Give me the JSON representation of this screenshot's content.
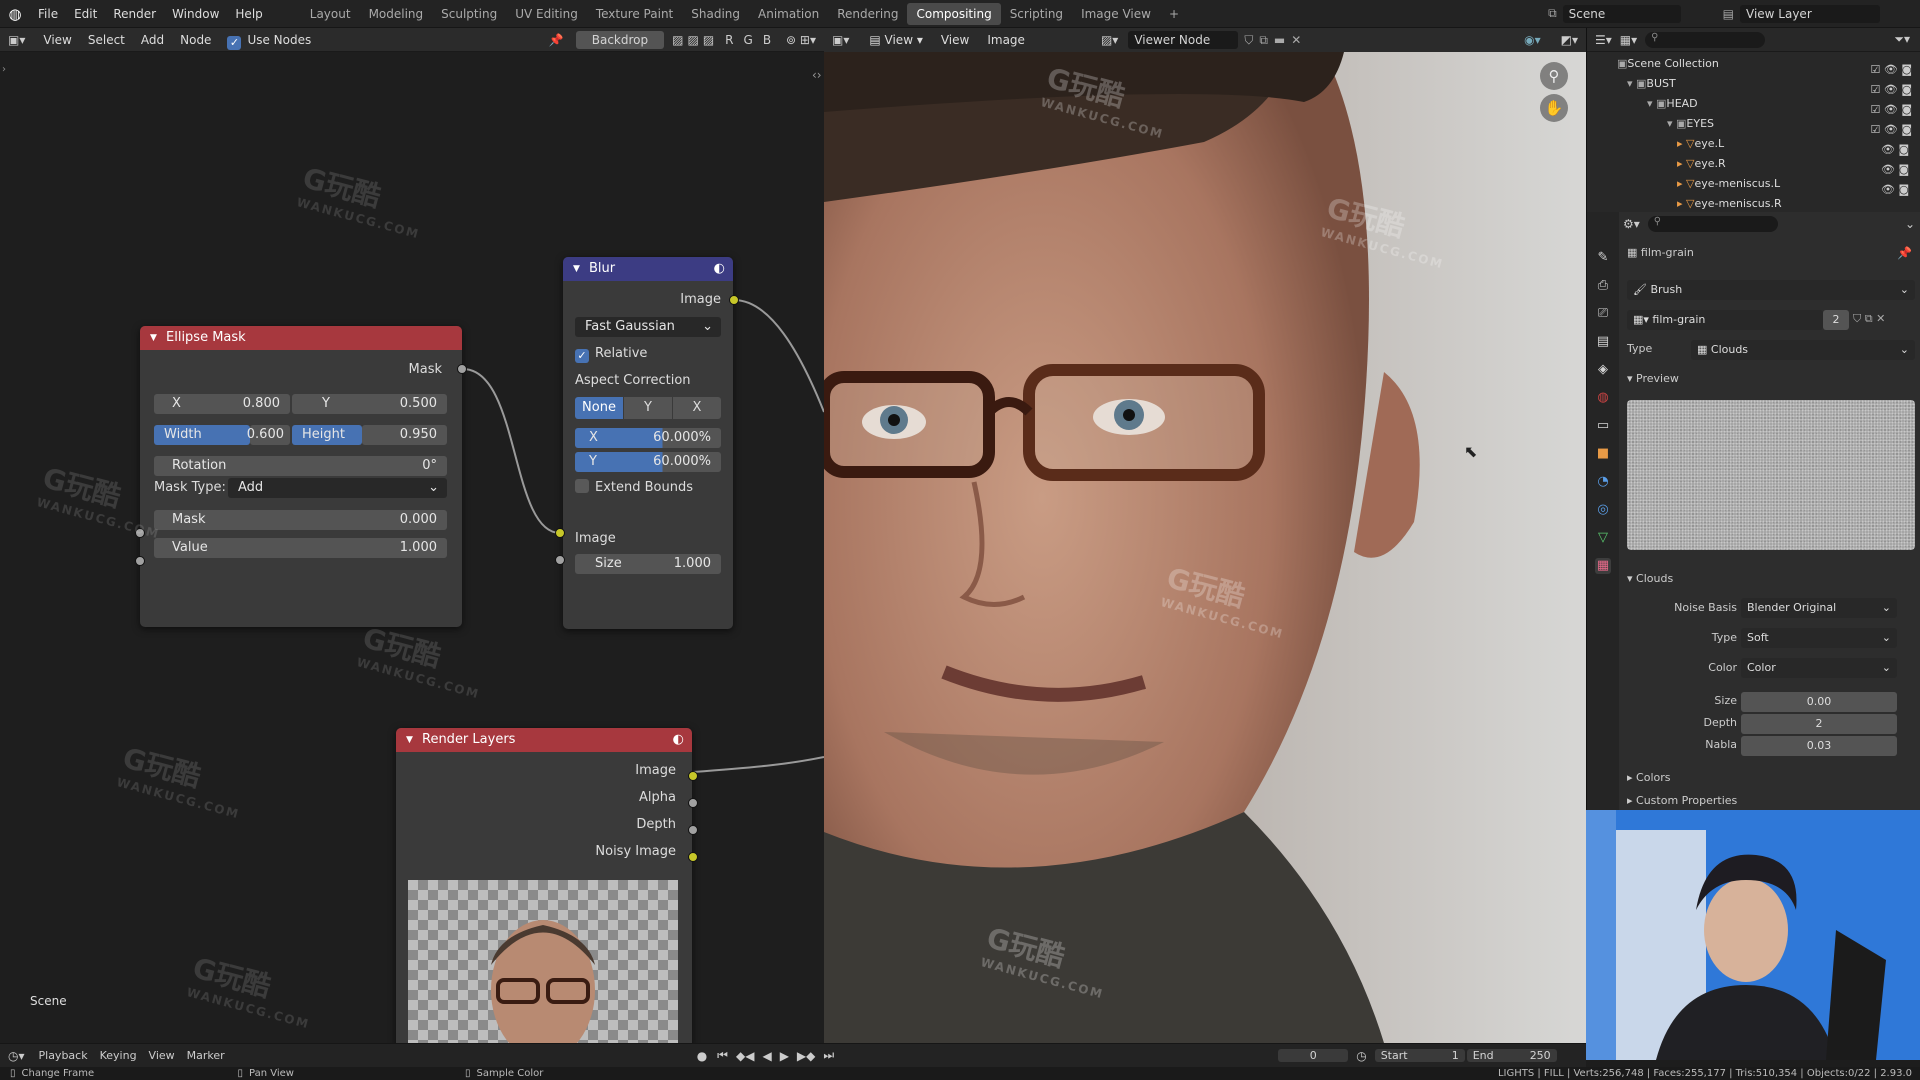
{
  "menu": {
    "file": "File",
    "edit": "Edit",
    "render": "Render",
    "window": "Window",
    "help": "Help"
  },
  "workspaces": [
    "Layout",
    "Modeling",
    "Sculpting",
    "UV Editing",
    "Texture Paint",
    "Shading",
    "Animation",
    "Rendering",
    "Compositing",
    "Scripting",
    "Image View"
  ],
  "active_workspace": "Compositing",
  "scene_label": "Scene",
  "view_layer_label": "View Layer",
  "node_header": {
    "view": "View",
    "select": "Select",
    "add": "Add",
    "node": "Node",
    "use_nodes": "Use Nodes",
    "backdrop": "Backdrop",
    "channels": [
      "R",
      "G",
      "B"
    ]
  },
  "viewer_header": {
    "view": "View",
    "view2": "View",
    "image": "Image",
    "viewer_node": "Viewer Node"
  },
  "ellipse_mask": {
    "title": "Ellipse Mask",
    "mask_out": "Mask",
    "x_label": "X",
    "x_val": "0.800",
    "y_label": "Y",
    "y_val": "0.500",
    "width_label": "Width",
    "width_val": "0.600",
    "height_label": "Height",
    "height_val": "0.950",
    "rotation_label": "Rotation",
    "rotation_val": "0°",
    "mask_type_label": "Mask Type:",
    "mask_type_val": "Add",
    "mask_in_label": "Mask",
    "mask_in_val": "0.000",
    "value_label": "Value",
    "value_val": "1.000"
  },
  "blur": {
    "title": "Blur",
    "image_out": "Image",
    "filter": "Fast Gaussian",
    "relative": "Relative",
    "aspect_label": "Aspect Correction",
    "aspect_opts": [
      "None",
      "Y",
      "X"
    ],
    "x_label": "X",
    "x_val": "60.000%",
    "y_label": "Y",
    "y_val": "60.000%",
    "extend": "Extend Bounds",
    "image_in": "Image",
    "size_label": "Size",
    "size_val": "1.000"
  },
  "render_layers": {
    "title": "Render Layers",
    "outputs": [
      "Image",
      "Alpha",
      "Depth",
      "Noisy Image"
    ]
  },
  "node_editor_scene": "Scene",
  "outliner": {
    "root": "Scene Collection",
    "rows": [
      {
        "name": "BUST"
      },
      {
        "name": "HEAD"
      },
      {
        "name": "EYES"
      },
      {
        "name": "eye.L"
      },
      {
        "name": "eye.R"
      },
      {
        "name": "eye-meniscus.L"
      },
      {
        "name": "eye-meniscus.R"
      }
    ]
  },
  "properties": {
    "texture_name": "film-grain",
    "brush_label": "Brush",
    "tex_slot": "film-grain",
    "users": "2",
    "type_label": "Type",
    "type_val": "Clouds",
    "preview_label": "Preview",
    "clouds_label": "Clouds",
    "noise_basis_label": "Noise Basis",
    "noise_basis_val": "Blender Original",
    "ctype_label": "Type",
    "ctype_val": "Soft",
    "color_label": "Color",
    "color_val": "Color",
    "size_label": "Size",
    "size_val": "0.00",
    "depth_label": "Depth",
    "depth_val": "2",
    "nabla_label": "Nabla",
    "nabla_val": "0.03",
    "colors_label": "Colors",
    "custom_label": "Custom Properties"
  },
  "timeline": {
    "playback": "Playback",
    "keying": "Keying",
    "view": "View",
    "marker": "Marker",
    "frame": "0",
    "start_label": "Start",
    "start_val": "1",
    "end_label": "End",
    "end_val": "250"
  },
  "statusbar": {
    "change_frame": "Change Frame",
    "pan_view": "Pan View",
    "sample_color": "Sample Color",
    "stats": "LIGHTS | FILL | Verts:256,748 | Faces:255,177 | Tris:510,354 | Objects:0/22 | 2.93.0"
  },
  "watermark": {
    "big": "G玩酷",
    "small": "WANKUCG.COM"
  },
  "colors": {
    "accent": "#4772b3",
    "socket_yellow": "#c7c729",
    "node_header_red": "#a7383e",
    "node_header_purple": "#3c3c83"
  }
}
